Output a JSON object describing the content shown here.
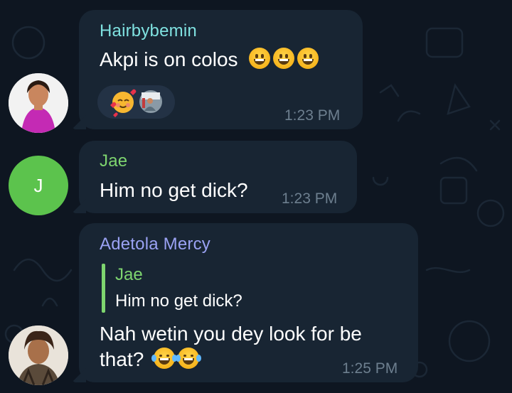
{
  "messages": [
    {
      "sender": "Hairbybemin",
      "sender_color": "#7fe1e0",
      "text": "Akpi is on colos",
      "emojis": [
        "grinning-face-emoji",
        "grinning-face-emoji",
        "grinning-face-emoji"
      ],
      "reactions": [
        "smiling-face-with-hearts-emoji",
        "reactor-avatar"
      ],
      "time": "1:23 PM"
    },
    {
      "sender": "Jae",
      "sender_color": "#7ed56f",
      "avatar_initial": "J",
      "avatar_color": "#5cc34d",
      "text": "Him no get dick?",
      "time": "1:23 PM"
    },
    {
      "sender": "Adetola Mercy",
      "sender_color": "#9aa2f3",
      "reply": {
        "sender": "Jae",
        "text": "Him no get dick?"
      },
      "text_line1": "Nah wetin you dey look for be",
      "text_line2": "that?",
      "emojis": [
        "face-with-tears-of-joy-emoji",
        "face-with-tears-of-joy-emoji"
      ],
      "time": "1:25 PM"
    }
  ],
  "colors": {
    "background": "#0e1621",
    "bubble": "#182533",
    "time": "#6d7f8f"
  }
}
